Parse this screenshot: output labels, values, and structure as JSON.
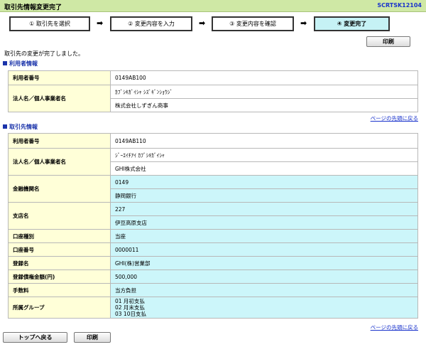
{
  "header": {
    "title": "取引先情報変更完了",
    "screen_code": "SCRTSK12104"
  },
  "steps": [
    {
      "label": "① 取引先を選択"
    },
    {
      "label": "② 変更内容を入力"
    },
    {
      "label": "③ 変更内容を確認"
    },
    {
      "label": "④ 変更完了"
    }
  ],
  "step_arrow": "➡",
  "print_button": "印刷",
  "message": "取引先の変更が完了しました。",
  "user_section": {
    "title": "利用者情報",
    "rows": [
      {
        "label": "利用者番号",
        "values": [
          "0149AB100"
        ]
      },
      {
        "label": "法人名／個人事業者名",
        "values": [
          "ｶﾌﾞｼｷｶﾞｲｼｬ ｼｽﾞｷﾞﾝｼｮｳｼﾞ",
          "株式会社しずぎん商事"
        ]
      }
    ]
  },
  "page_top_link": "ページの先頭に戻る",
  "partner_section": {
    "title": "取引先情報",
    "rows": [
      {
        "label": "利用者番号",
        "values": [
          "0149AB110"
        ]
      },
      {
        "label": "法人名／個人事業者名",
        "values": [
          "ｼﾞｰｴｲﾁｱｲ ｶﾌﾞｼｷｶﾞｲｼｬ",
          "GHI株式会社"
        ]
      },
      {
        "label": "金融機関名",
        "values": [
          "0149",
          "静岡銀行"
        ]
      },
      {
        "label": "支店名",
        "values": [
          "227",
          "伊豆高原支店"
        ]
      },
      {
        "label": "口座種別",
        "values": [
          "当座"
        ]
      },
      {
        "label": "口座番号",
        "values": [
          "0000011"
        ]
      },
      {
        "label": "登録名",
        "values": [
          "GHI(株)営業部"
        ]
      },
      {
        "label": "登録債権金額(円)",
        "values": [
          "500,000"
        ]
      },
      {
        "label": "手数料",
        "values": [
          "当方負担"
        ]
      },
      {
        "label": "所属グループ",
        "values": [
          "01 月初支払",
          "02 月末支払",
          "03 10日支払"
        ]
      }
    ]
  },
  "footer": {
    "back_to_top_button": "トップへ戻る",
    "print_button": "印刷"
  }
}
